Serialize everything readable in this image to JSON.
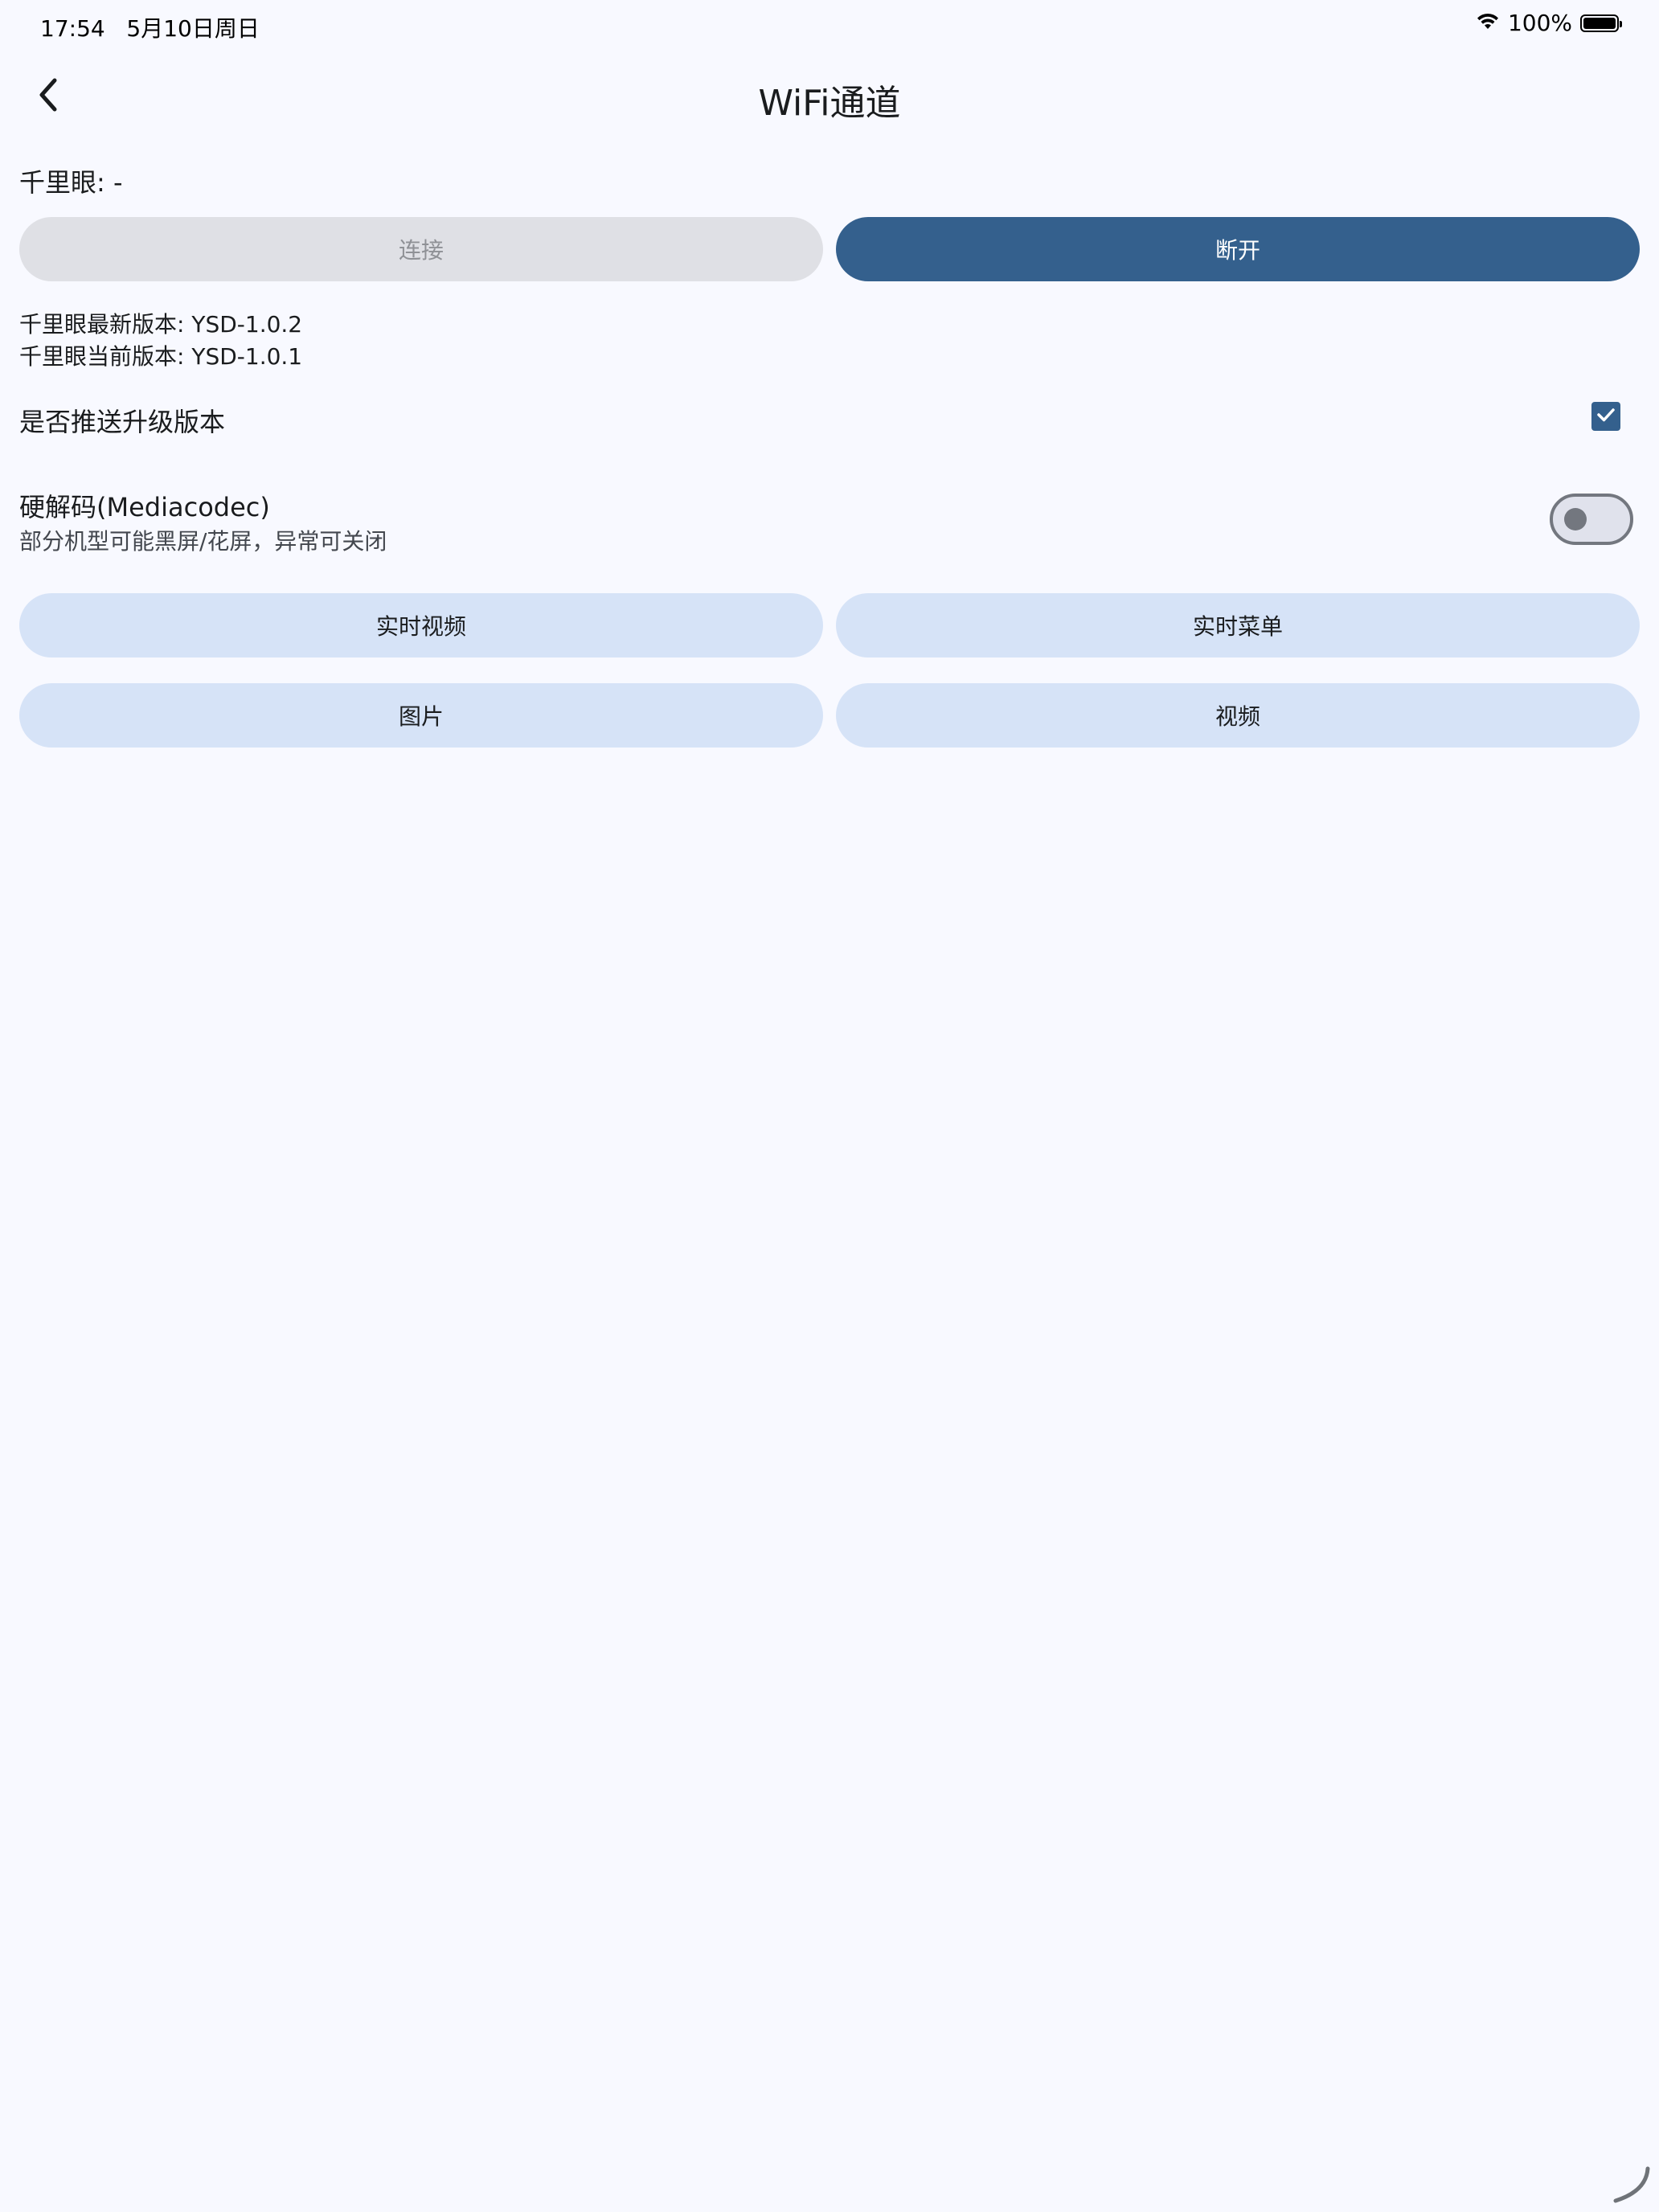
{
  "status_bar": {
    "time_date": "17:54   5月10日周日",
    "battery_percent": "100%",
    "battery_level": 1.0,
    "icons": [
      "wifi-icon",
      "battery-icon"
    ]
  },
  "app_bar": {
    "title": "WiFi通道",
    "back_icon": "chevron-left-icon"
  },
  "device": {
    "label": "千里眼: -"
  },
  "connection_buttons": {
    "connect": "连接",
    "disconnect": "断开"
  },
  "versions": {
    "latest": "千里眼最新版本: YSD-1.0.2",
    "current": "千里眼当前版本: YSD-1.0.1"
  },
  "push_upgrade": {
    "label": "是否推送升级版本",
    "checked": true
  },
  "hardware_decode": {
    "label": "硬解码(Mediacodec)",
    "subtitle": "部分机型可能黑屏/花屏，异常可关闭",
    "enabled": false
  },
  "actions": {
    "live_video": "实时视频",
    "live_menu": "实时菜单",
    "pictures": "图片",
    "videos": "视频"
  },
  "colors": {
    "background": "#f8f9ff",
    "primary": "#34608d",
    "tonal": "#d6e3f7",
    "disabled": "#dfe0e5"
  }
}
